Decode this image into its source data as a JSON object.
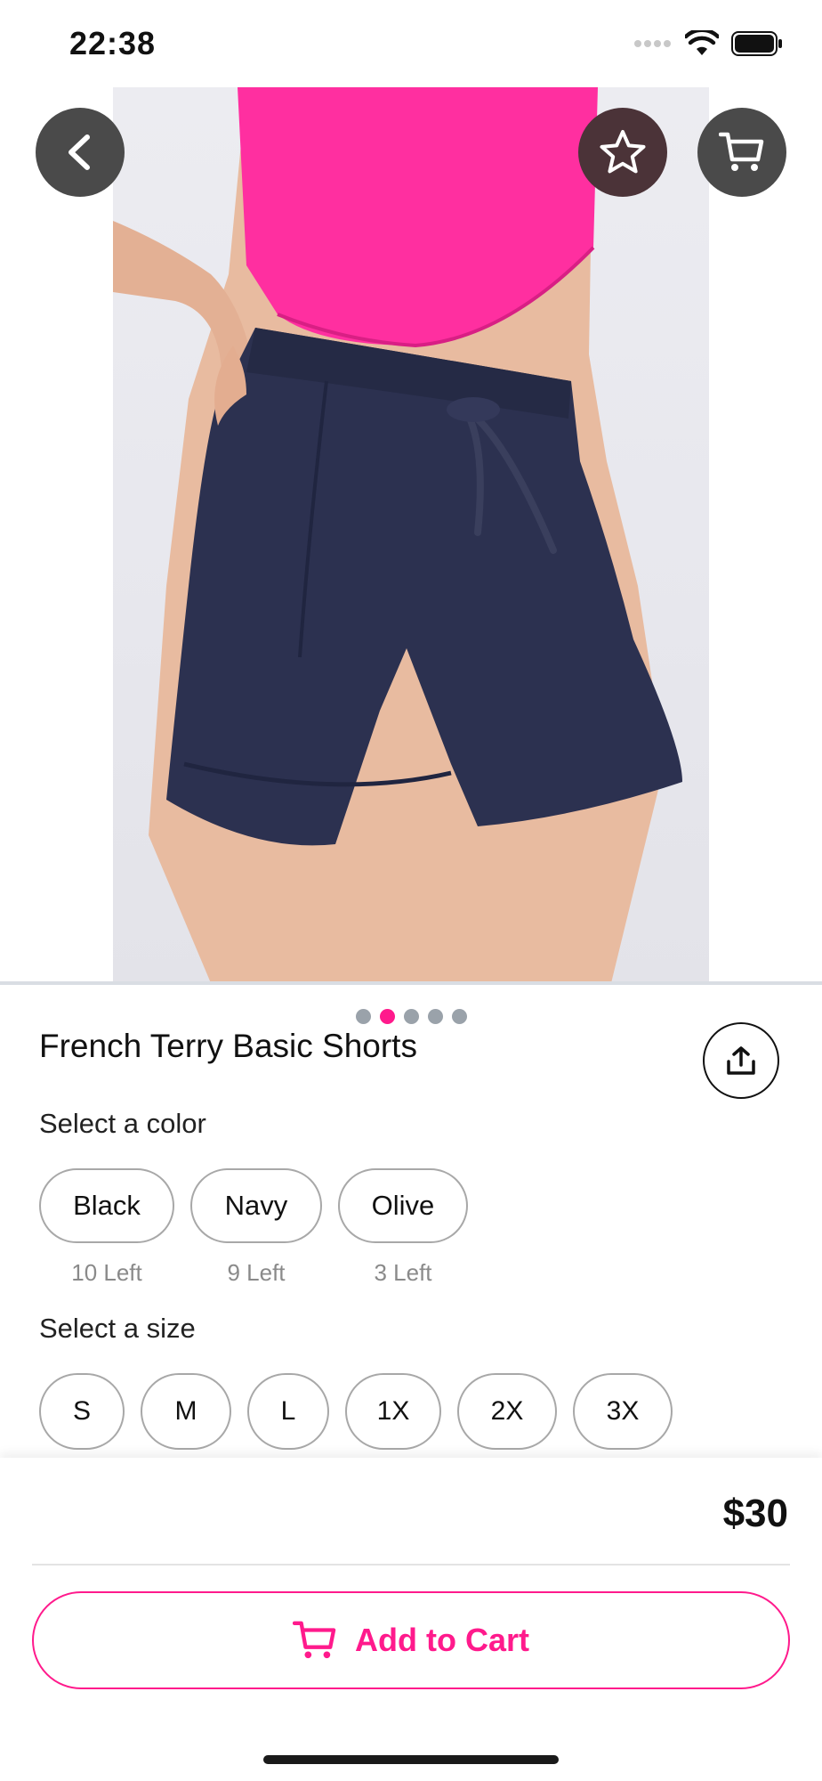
{
  "status_bar": {
    "time": "22:38"
  },
  "product": {
    "title": "French Terry Basic Shorts",
    "gallery": {
      "image_count": 5,
      "active_index": 1
    }
  },
  "colors": {
    "label": "Select a color",
    "options": [
      {
        "name": "Black",
        "stock": "10 Left"
      },
      {
        "name": "Navy",
        "stock": "9 Left"
      },
      {
        "name": "Olive",
        "stock": "3 Left"
      }
    ]
  },
  "sizes": {
    "label": "Select a size",
    "options": [
      "S",
      "M",
      "L",
      "1X",
      "2X",
      "3X"
    ]
  },
  "footer": {
    "price": "$30",
    "add_to_cart_label": "Add to Cart"
  },
  "icons": {
    "back": "chevron-left-icon",
    "favorite": "star-icon",
    "cart": "cart-icon",
    "share": "share-icon"
  },
  "theme": {
    "accent": "#ff1a8c",
    "shirt": "#ff2fa0",
    "shorts": "#2c3150"
  }
}
